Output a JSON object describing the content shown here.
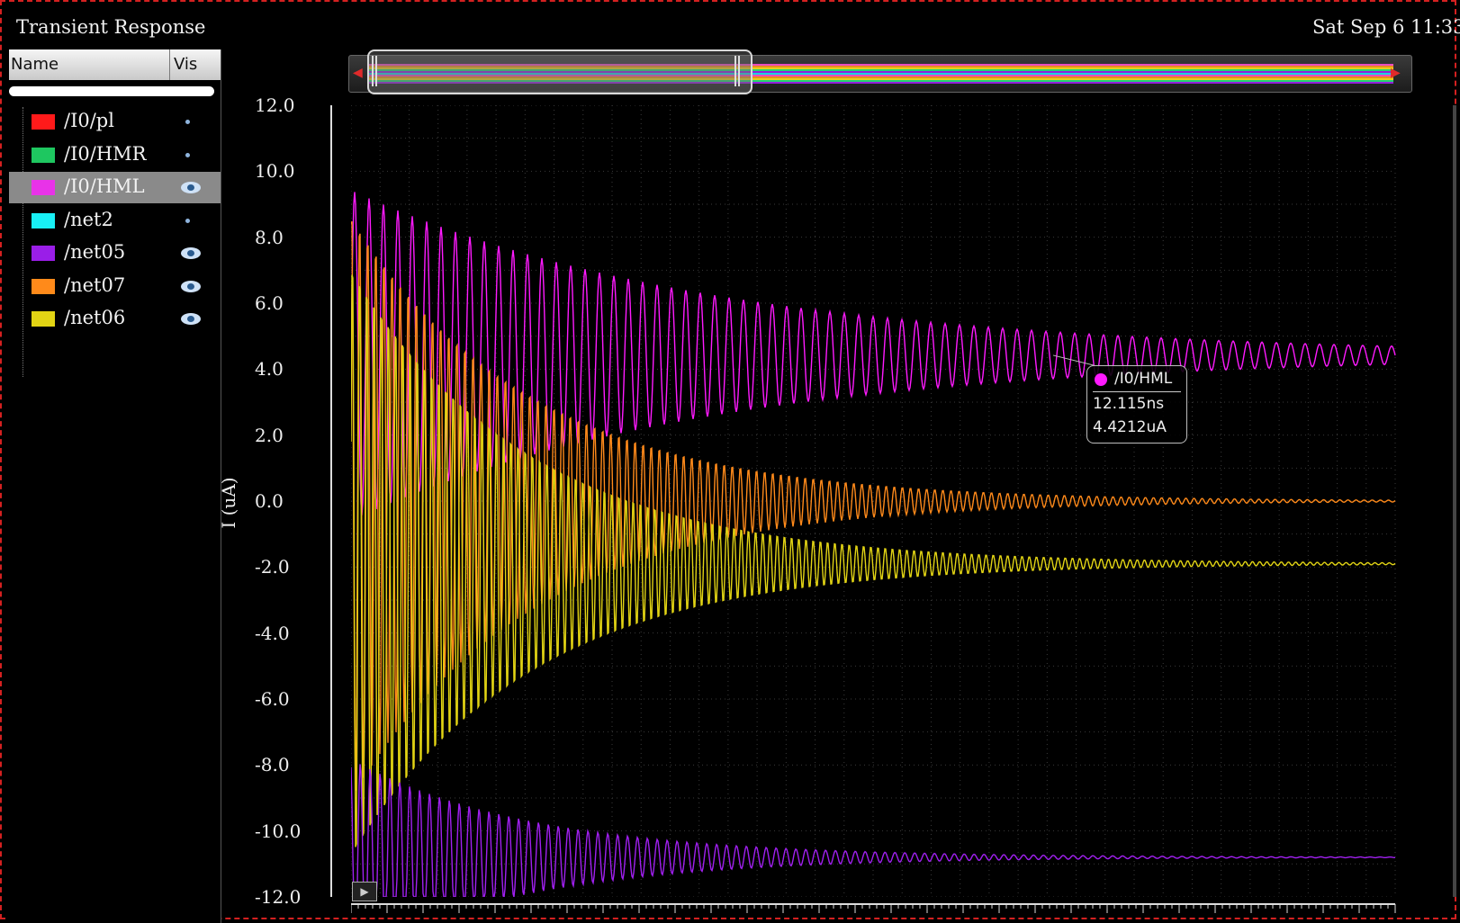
{
  "window": {
    "title": "Transient Response",
    "datetime": "Sat Sep 6 11:33:"
  },
  "signal_list": {
    "header_name": "Name",
    "header_vis": "Vis",
    "items": [
      {
        "label": "/I0/pl",
        "color": "#ff1a1a",
        "visible": false,
        "selected": false
      },
      {
        "label": "/I0/HMR",
        "color": "#1ec760",
        "visible": false,
        "selected": false
      },
      {
        "label": "/I0/HML",
        "color": "#e833e8",
        "visible": true,
        "selected": true
      },
      {
        "label": "/net2",
        "color": "#18f0f5",
        "visible": false,
        "selected": false
      },
      {
        "label": "/net05",
        "color": "#9a1ee8",
        "visible": true,
        "selected": false
      },
      {
        "label": "/net07",
        "color": "#ff8a1a",
        "visible": true,
        "selected": false
      },
      {
        "label": "/net06",
        "color": "#e2d414",
        "visible": true,
        "selected": false
      }
    ]
  },
  "tooltip": {
    "signal": "/I0/HML",
    "x": "12.115ns",
    "y": "4.4212uA",
    "color": "#ff1aff"
  },
  "chart_data": {
    "type": "line",
    "title": "",
    "xlabel": "",
    "ylabel": "I (uA)",
    "ylim": [
      -12.0,
      12.0
    ],
    "yticks": [
      "12.0",
      "10.0",
      "8.0",
      "6.0",
      "4.0",
      "2.0",
      "0.0",
      "-2.0",
      "-4.0",
      "-6.0",
      "-8.0",
      "-10.0",
      "-12.0"
    ],
    "grid": true,
    "series": [
      {
        "name": "/I0/HML",
        "color": "#ff1aff",
        "final": 4.42,
        "start": 10.8,
        "amp0": 5.0,
        "decay": 10,
        "period": 16,
        "phase": 0
      },
      {
        "name": "/net07",
        "color": "#ff8a1a",
        "final": 0.0,
        "start": 4.5,
        "amp0": 9.0,
        "decay": 5,
        "period": 9,
        "phase": 1.2
      },
      {
        "name": "/net06",
        "color": "#e2d414",
        "final": -1.9,
        "start": 0.5,
        "amp0": 9.5,
        "decay": 5,
        "period": 8,
        "phase": 0.4
      },
      {
        "name": "/net05",
        "color": "#a020f0",
        "final": -10.8,
        "start": 1.0,
        "amp0": 3.0,
        "decay": 5,
        "period": 11,
        "phase": 2.0
      }
    ]
  }
}
